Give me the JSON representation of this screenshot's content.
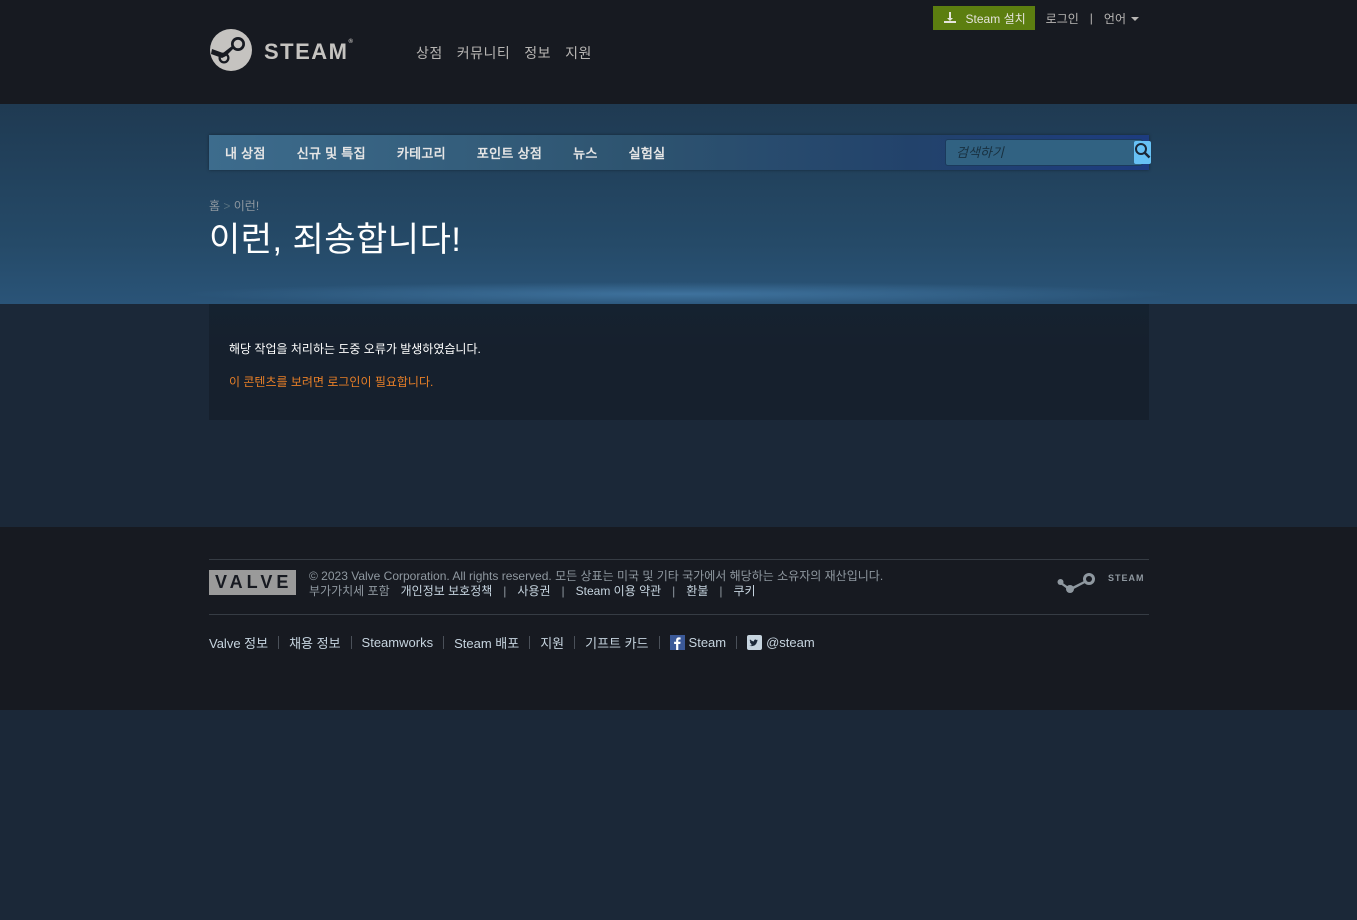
{
  "header": {
    "install_label": "Steam 설치",
    "login_label": "로그인",
    "util_sep": "|",
    "language_label": "언어",
    "logo_word": "STEAM",
    "logo_reg": "®",
    "main_nav": [
      "상점",
      "커뮤니티",
      "정보",
      "지원"
    ]
  },
  "store_nav": {
    "tabs": [
      "내 상점",
      "신규 및 특집",
      "카테고리",
      "포인트 상점",
      "뉴스",
      "실험실"
    ],
    "search_placeholder": "검색하기"
  },
  "breadcrumb": {
    "home": "홈",
    "sep": ">",
    "current": "이런!"
  },
  "page_title": "이런, 죄송합니다!",
  "error": {
    "message": "해당 작업을 처리하는 도중 오류가 발생하였습니다.",
    "login_required": "이 콘텐츠를 보려면 로그인이 필요합니다."
  },
  "footer": {
    "valve_logo": "VALVE",
    "copyright": "© 2023 Valve Corporation. All rights reserved. 모든 상표는 미국 및 기타 국가에서 해당하는 소유자의 재산입니다.",
    "vat_note": "부가가치세 포함",
    "legal_links": [
      "개인정보 보호정책",
      "사용권",
      "Steam 이용 약관",
      "환불",
      "쿠키"
    ],
    "legal_sep": "|",
    "steam_logo_word": "STEAM",
    "links": [
      "Valve 정보",
      "채용 정보",
      "Steamworks",
      "Steam 배포",
      "지원",
      "기프트 카드"
    ],
    "facebook_label": "Steam",
    "twitter_label": "@steam"
  },
  "colors": {
    "background": "#1b2838",
    "header": "#171a21",
    "install_button": "#5c7e10",
    "login_notice": "#e87f27",
    "search_button": "#67c1f5"
  }
}
